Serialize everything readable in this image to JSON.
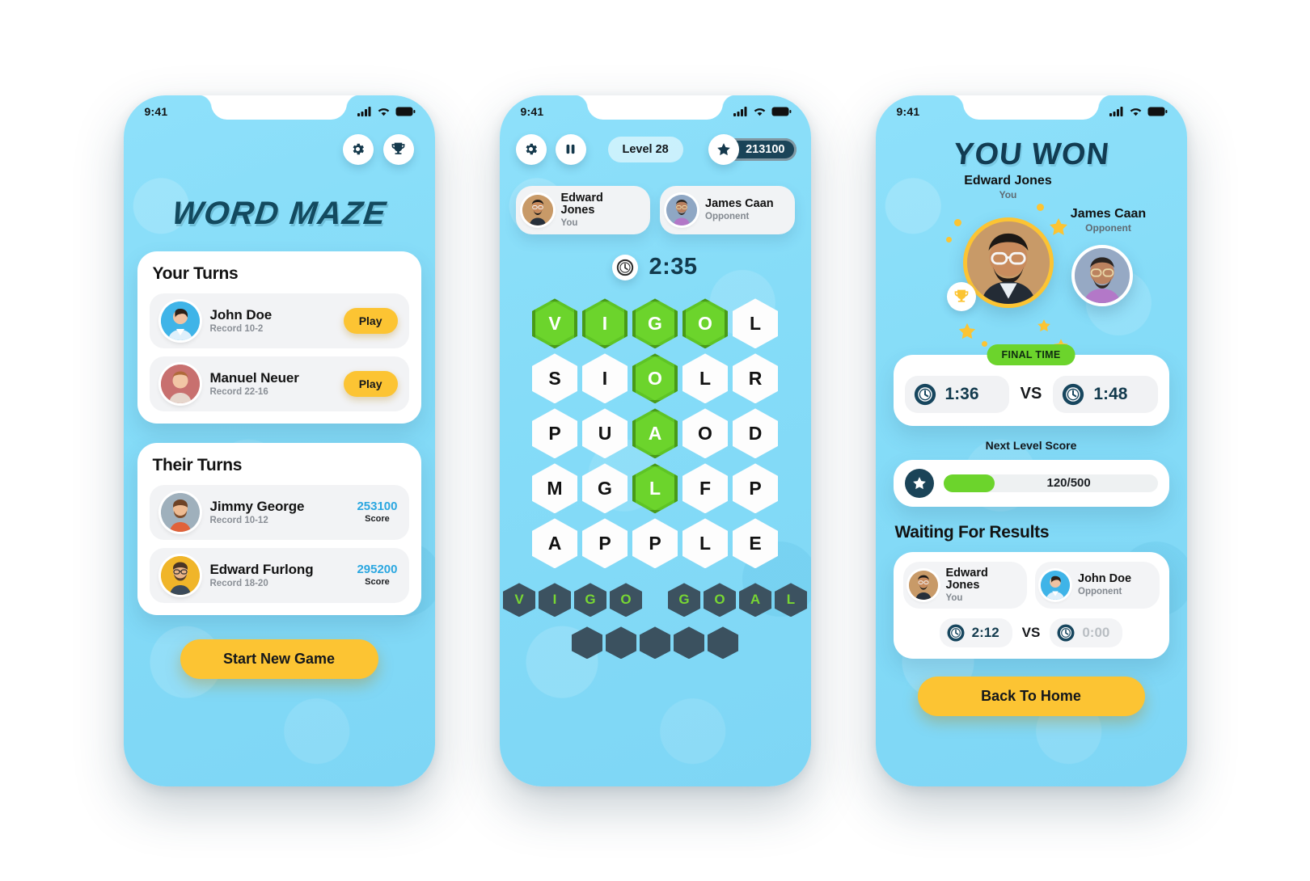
{
  "statusbar": {
    "time": "9:41",
    "signal_icon": "cellular-signal-icon",
    "wifi_icon": "wifi-icon",
    "battery_icon": "battery-icon"
  },
  "screen1": {
    "settings_icon": "gear-icon",
    "trophy_icon": "trophy-icon",
    "title": "WORD MAZE",
    "your_turns": {
      "heading": "Your Turns",
      "items": [
        {
          "name": "John Doe",
          "record": "Record 10-2",
          "action": "Play",
          "avatar_bg": "#3fb4e8"
        },
        {
          "name": "Manuel Neuer",
          "record": "Record 22-16",
          "action": "Play",
          "avatar_bg": "#c8706f"
        }
      ]
    },
    "their_turns": {
      "heading": "Their Turns",
      "items": [
        {
          "name": "Jimmy George",
          "record": "Record 10-12",
          "score": "253100",
          "score_label": "Score",
          "avatar_bg": "#9fb0bc"
        },
        {
          "name": "Edward Furlong",
          "record": "Record 18-20",
          "score": "295200",
          "score_label": "Score",
          "avatar_bg": "#f0b529"
        }
      ]
    },
    "start_button": "Start New Game"
  },
  "screen2": {
    "settings_icon": "gear-icon",
    "pause_icon": "pause-icon",
    "level": "Level 28",
    "star_icon": "star-icon",
    "score": "213100",
    "players": [
      {
        "name": "Edward Jones",
        "role": "You",
        "avatar_bg": "#c89a68"
      },
      {
        "name": "James Caan",
        "role": "Opponent",
        "avatar_bg": "#8fa7c4"
      }
    ],
    "timer_icon": "clock-icon",
    "timer": "2:35",
    "grid": [
      [
        {
          "l": "V",
          "on": true
        },
        {
          "l": "I",
          "on": true
        },
        {
          "l": "G",
          "on": true
        },
        {
          "l": "O",
          "on": true
        },
        {
          "l": "L",
          "on": false
        }
      ],
      [
        {
          "l": "S",
          "on": false
        },
        {
          "l": "I",
          "on": false
        },
        {
          "l": "O",
          "on": true
        },
        {
          "l": "L",
          "on": false
        },
        {
          "l": "R",
          "on": false
        }
      ],
      [
        {
          "l": "P",
          "on": false
        },
        {
          "l": "U",
          "on": false
        },
        {
          "l": "A",
          "on": true
        },
        {
          "l": "O",
          "on": false
        },
        {
          "l": "D",
          "on": false
        }
      ],
      [
        {
          "l": "M",
          "on": false
        },
        {
          "l": "G",
          "on": false
        },
        {
          "l": "L",
          "on": true
        },
        {
          "l": "F",
          "on": false
        },
        {
          "l": "P",
          "on": false
        }
      ],
      [
        {
          "l": "A",
          "on": false
        },
        {
          "l": "P",
          "on": false
        },
        {
          "l": "P",
          "on": false
        },
        {
          "l": "L",
          "on": false
        },
        {
          "l": "E",
          "on": false
        }
      ]
    ],
    "found_words": [
      "VIGO",
      "GOAL"
    ],
    "pending_slots": 5
  },
  "screen3": {
    "title": "YOU WON",
    "winner": {
      "name": "Edward Jones",
      "role": "You",
      "avatar_bg": "#c89a68"
    },
    "loser": {
      "name": "James Caan",
      "role": "Opponent",
      "avatar_bg": "#8fa7c4"
    },
    "trophy_icon": "trophy-icon",
    "final_time_badge": "FINAL TIME",
    "final_times": {
      "you": "1:36",
      "opponent": "1:48",
      "vs": "VS",
      "clock_icon": "clock-icon"
    },
    "next_level_label": "Next Level Score",
    "progress": {
      "star_icon": "star-icon",
      "text": "120/500",
      "value": 120,
      "max": 500,
      "percent": 24,
      "fill_color": "#6cd42c"
    },
    "waiting_title": "Waiting For Results",
    "waiting_players": [
      {
        "name": "Edward Jones",
        "role": "You",
        "avatar_bg": "#c89a68"
      },
      {
        "name": "John Doe",
        "role": "Opponent",
        "avatar_bg": "#3fb4e8"
      }
    ],
    "waiting_times": {
      "you": "2:12",
      "opponent": "0:00",
      "vs": "VS",
      "clock_icon": "clock-icon"
    },
    "back_button": "Back To Home"
  },
  "colors": {
    "bg_blue": "#85dcf8",
    "accent_yellow": "#fcc433",
    "accent_green": "#6cd42c",
    "dark_navy": "#123c52",
    "score_blue": "#2ba7e0"
  }
}
